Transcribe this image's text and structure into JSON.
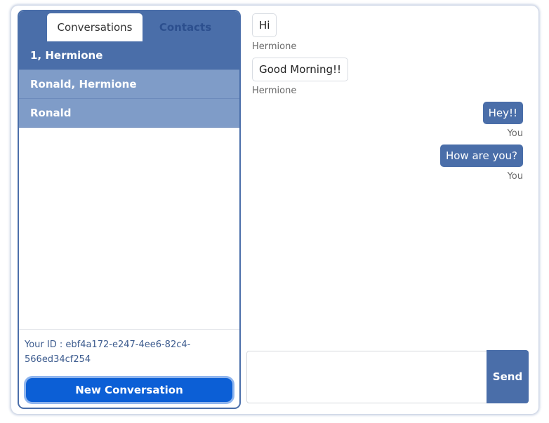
{
  "tabs": [
    {
      "label": "Conversations",
      "active": true
    },
    {
      "label": "Contacts",
      "active": false
    }
  ],
  "conversations": [
    {
      "label": "1, Hermione",
      "selected": true
    },
    {
      "label": "Ronald, Hermione",
      "selected": false
    },
    {
      "label": "Ronald",
      "selected": false
    }
  ],
  "your_id": "Your ID : ebf4a172-e247-4ee6-82c4-566ed34cf254",
  "new_conversation_label": "New Conversation",
  "messages": [
    {
      "text": "Hi",
      "sender": "Hermione",
      "direction": "incoming"
    },
    {
      "text": "Good Morning!!",
      "sender": "Hermione",
      "direction": "incoming"
    },
    {
      "text": "Hey!!",
      "sender": "You",
      "direction": "outgoing"
    },
    {
      "text": "How are you?",
      "sender": "You",
      "direction": "outgoing"
    }
  ],
  "composer": {
    "value": "",
    "send_label": "Send"
  },
  "colors": {
    "primary": "#4a6ea9",
    "list_item": "#7f9cc8",
    "new_button": "#0c5fd6"
  }
}
